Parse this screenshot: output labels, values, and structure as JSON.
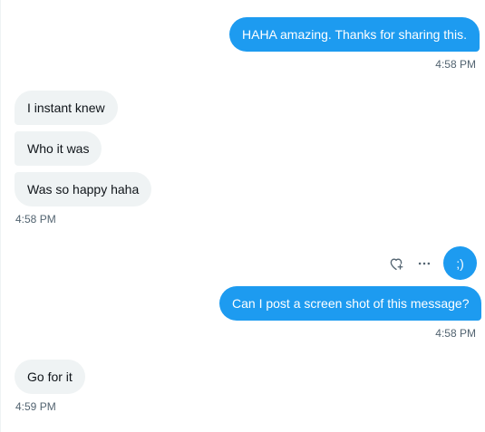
{
  "messages": [
    {
      "id": "m1",
      "direction": "sent",
      "text": "HAHA amazing. Thanks for sharing this."
    },
    {
      "id": "m2",
      "direction": "received",
      "text": "I instant knew"
    },
    {
      "id": "m3",
      "direction": "received",
      "text": "Who it was"
    },
    {
      "id": "m4",
      "direction": "received",
      "text": "Was so happy haha"
    },
    {
      "id": "m5",
      "direction": "sent",
      "text": ";)"
    },
    {
      "id": "m6",
      "direction": "sent",
      "text": "Can I post a screen shot of this message?"
    },
    {
      "id": "m7",
      "direction": "received",
      "text": "Go for it"
    }
  ],
  "timestamps": {
    "t1": "4:58 PM",
    "t2": "4:58 PM",
    "t3": "4:58 PM",
    "t4": "4:59 PM"
  },
  "actions": {
    "like_icon": "heart-plus-icon",
    "more_icon": "more-dots-icon"
  },
  "colors": {
    "sent_bubble": "#1d9bf0",
    "received_bubble": "#eff3f4",
    "timestamp": "#536471",
    "text_dark": "#0f1419"
  }
}
